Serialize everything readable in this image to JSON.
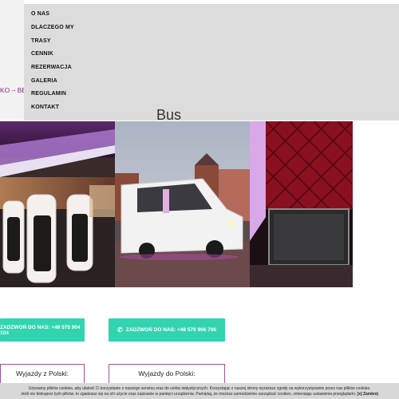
{
  "nav": {
    "items": [
      {
        "label": "O NAS"
      },
      {
        "label": "DLACZEGO MY"
      },
      {
        "label": "TRASY"
      },
      {
        "label": "CENNIK"
      },
      {
        "label": "REZERWACJA"
      },
      {
        "label": "GALERIA"
      },
      {
        "label": "REGULAMIN"
      },
      {
        "label": "KONTAKT"
      }
    ]
  },
  "header": {
    "tagline_fragment": "KO – BE",
    "bus_heading": "Bus"
  },
  "gallery": [
    {
      "name": "interior-seats-photo"
    },
    {
      "name": "white-bus-photo"
    },
    {
      "name": "red-quilted-interior-tv-photo"
    }
  ],
  "cta": {
    "phone1_label": "ZADZWOŃ DO NAS: +48 575 904 104",
    "phone2_label": "ZADZWOŃ DO NAS: +48 570 906 706",
    "icon": "phone-icon",
    "color": "#32d4b0"
  },
  "destinations": {
    "from_poland": "Wyjazdy z Polski:",
    "to_poland": "Wyjazdy do Polski:",
    "border_color": "#a052a0"
  },
  "cookie": {
    "line1": "Używamy plików cookies, aby ułatwić Ci korzystanie z naszego serwisu oraz do celów statystycznych. Korzystając z naszej strony wyrażasz zgodę na wykorzystywanie przez nas plików cookies.",
    "line2": "Jeśli nie blokujesz tych plików, to zgadzasz się na ich użycie oraz zapisanie w pamięci urządzenia. Pamiętaj, że możesz samodzielnie zarządzać cookies, zmieniając ustawienia przeglądarki.",
    "close_label": "[x] Zamknij"
  }
}
